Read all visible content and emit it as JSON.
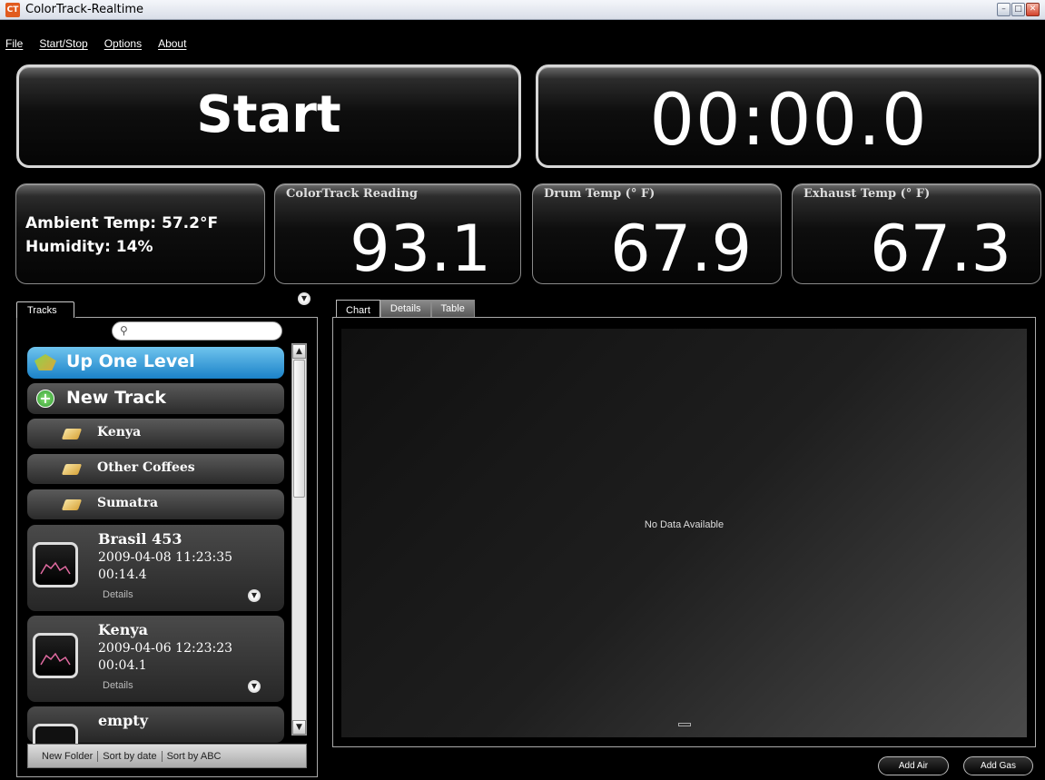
{
  "window": {
    "title": "ColorTrack-Realtime",
    "app_icon": "CT",
    "controls": [
      "–",
      "□",
      "✕"
    ]
  },
  "menu": {
    "items": [
      "File",
      "Start/Stop",
      "Options",
      "About"
    ]
  },
  "main": {
    "start_label": "Start",
    "timer": "00:00.0"
  },
  "ambient": {
    "temp": "Ambient Temp:  57.2°F",
    "humidity": "Humidity:  14%"
  },
  "metrics": [
    {
      "title": "ColorTrack Reading",
      "value": "93.1"
    },
    {
      "title": "Drum Temp (° F)",
      "value": "67.9"
    },
    {
      "title": "Exhaust Temp (° F)",
      "value": "67.3"
    }
  ],
  "tracks": {
    "tab_label": "Tracks",
    "search_placeholder": "",
    "up_label": "Up One Level",
    "new_label": "New Track",
    "folders": [
      "Kenya",
      "Other Coffees",
      "Sumatra"
    ],
    "items": [
      {
        "name": "Brasil 453",
        "date": "2009-04-08 11:23:35",
        "duration": "00:14.4",
        "details": "Details"
      },
      {
        "name": "Kenya",
        "date": "2009-04-06 12:23:23",
        "duration": "00:04.1",
        "details": "Details"
      },
      {
        "name": "empty"
      }
    ],
    "bottom_actions": [
      "New Folder",
      "Sort by date",
      "Sort by ABC"
    ]
  },
  "chart_panel": {
    "tabs": [
      "Chart",
      "Details",
      "Table"
    ],
    "active_tab": "Chart",
    "empty_message": "No Data Available"
  },
  "actions": {
    "add_air": "Add Air",
    "add_gas": "Add Gas"
  },
  "colors": {
    "accent": "#1b82c8",
    "background": "#000000"
  }
}
